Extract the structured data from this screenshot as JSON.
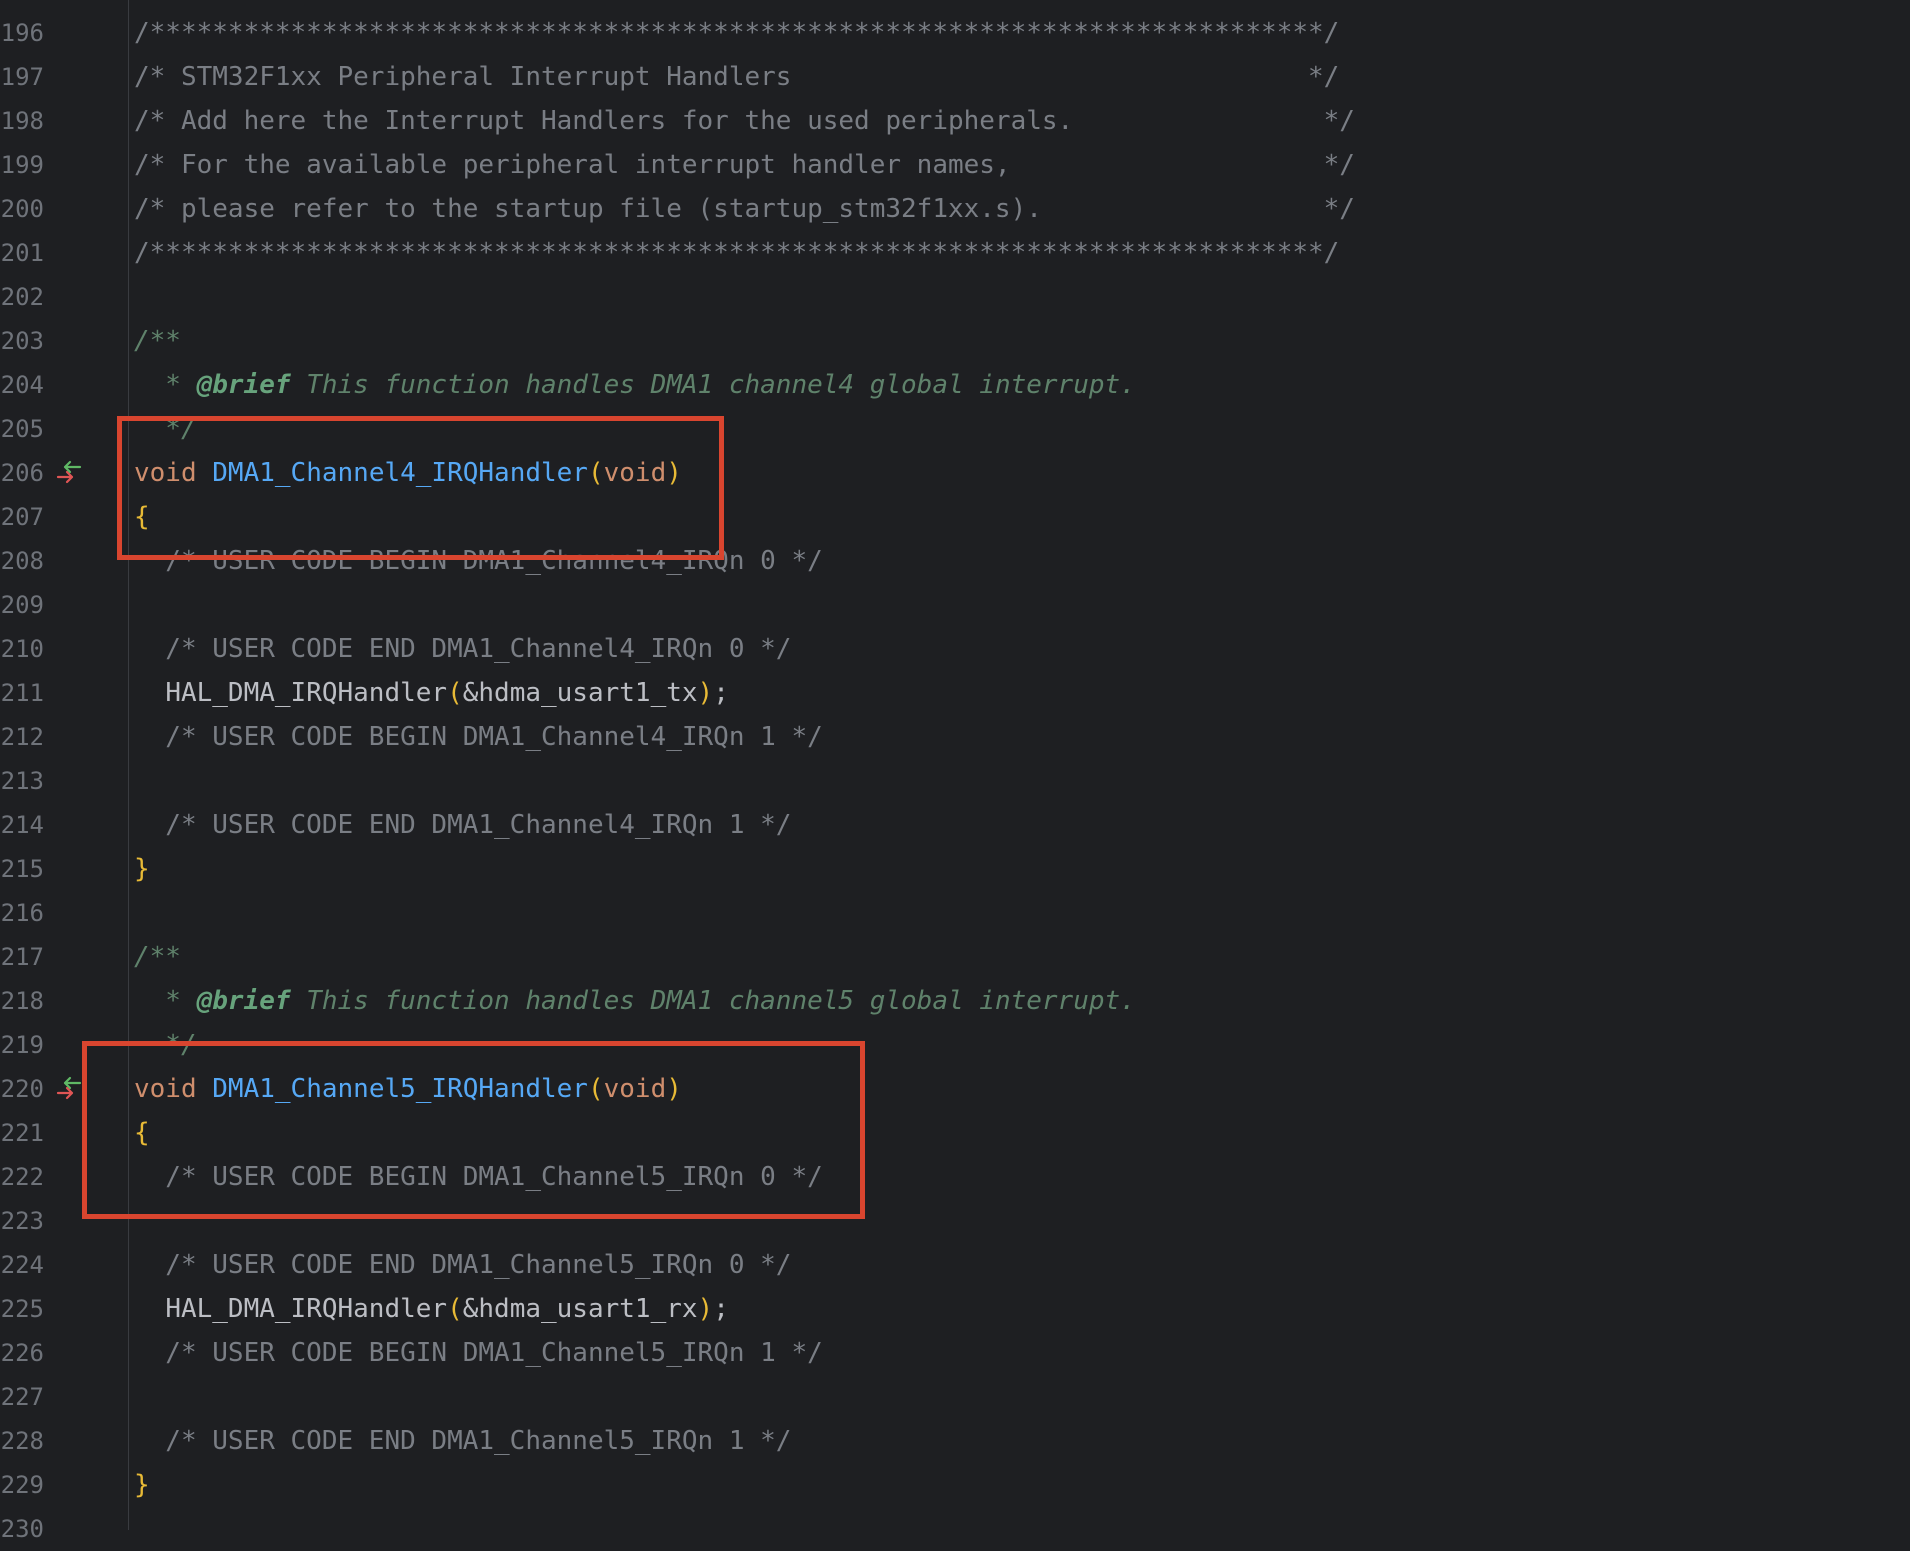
{
  "editor": {
    "lines": [
      {
        "num": "196",
        "text": "/***************************************************************************/",
        "style": "cmt"
      },
      {
        "num": "197",
        "text": "/* STM32F1xx Peripheral Interrupt Handlers                                 */",
        "style": "cmt"
      },
      {
        "num": "198",
        "text": "/* Add here the Interrupt Handlers for the used peripherals.                */",
        "style": "cmt"
      },
      {
        "num": "199",
        "text": "/* For the available peripheral interrupt handler names,                    */",
        "style": "cmt"
      },
      {
        "num": "200",
        "text": "/* please refer to the startup file (startup_stm32f1xx.s).                  */",
        "style": "cmt"
      },
      {
        "num": "201",
        "text": "/***************************************************************************/",
        "style": "cmt"
      },
      {
        "num": "202",
        "text": "",
        "style": "plain"
      },
      {
        "num": "203",
        "text": "/**",
        "style": "doc"
      },
      {
        "num": "204",
        "text": "  * @brief This function handles DMA1 channel4 global interrupt.",
        "style": "brief"
      },
      {
        "num": "205",
        "text": "  */",
        "style": "doc"
      },
      {
        "num": "206",
        "text": "void DMA1_Channel4_IRQHandler(void)",
        "style": "sig",
        "gutter_icon": "implementation-arrows-icon"
      },
      {
        "num": "207",
        "text": "{",
        "style": "brace"
      },
      {
        "num": "208",
        "text": "  /* USER CODE BEGIN DMA1_Channel4_IRQn 0 */",
        "style": "cmt"
      },
      {
        "num": "209",
        "text": "",
        "style": "plain"
      },
      {
        "num": "210",
        "text": "  /* USER CODE END DMA1_Channel4_IRQn 0 */",
        "style": "cmt"
      },
      {
        "num": "211",
        "text": "  HAL_DMA_IRQHandler(&hdma_usart1_tx);",
        "style": "call"
      },
      {
        "num": "212",
        "text": "  /* USER CODE BEGIN DMA1_Channel4_IRQn 1 */",
        "style": "cmt"
      },
      {
        "num": "213",
        "text": "",
        "style": "plain"
      },
      {
        "num": "214",
        "text": "  /* USER CODE END DMA1_Channel4_IRQn 1 */",
        "style": "cmt"
      },
      {
        "num": "215",
        "text": "}",
        "style": "brace"
      },
      {
        "num": "216",
        "text": "",
        "style": "plain"
      },
      {
        "num": "217",
        "text": "/**",
        "style": "doc"
      },
      {
        "num": "218",
        "text": "  * @brief This function handles DMA1 channel5 global interrupt.",
        "style": "brief"
      },
      {
        "num": "219",
        "text": "  */",
        "style": "doc"
      },
      {
        "num": "220",
        "text": "void DMA1_Channel5_IRQHandler(void)",
        "style": "sig",
        "gutter_icon": "implementation-arrows-icon"
      },
      {
        "num": "221",
        "text": "{",
        "style": "brace"
      },
      {
        "num": "222",
        "text": "  /* USER CODE BEGIN DMA1_Channel5_IRQn 0 */",
        "style": "cmt"
      },
      {
        "num": "223",
        "text": "",
        "style": "plain"
      },
      {
        "num": "224",
        "text": "  /* USER CODE END DMA1_Channel5_IRQn 0 */",
        "style": "cmt"
      },
      {
        "num": "225",
        "text": "  HAL_DMA_IRQHandler(&hdma_usart1_rx);",
        "style": "call"
      },
      {
        "num": "226",
        "text": "  /* USER CODE BEGIN DMA1_Channel5_IRQn 1 */",
        "style": "cmt"
      },
      {
        "num": "227",
        "text": "",
        "style": "plain"
      },
      {
        "num": "228",
        "text": "  /* USER CODE END DMA1_Channel5_IRQn 1 */",
        "style": "cmt"
      },
      {
        "num": "229",
        "text": "}",
        "style": "brace"
      },
      {
        "num": "230",
        "text": "",
        "style": "plain"
      }
    ]
  },
  "colors": {
    "background": "#1e1f22",
    "line_number": "#6f737a",
    "comment": "#7a7e85",
    "doc_comment": "#5f826b",
    "doc_tag": "#67a37c",
    "keyword": "#cf8e6d",
    "function": "#56a8f5",
    "brace": "#e8ba36",
    "plain": "#bcbec4",
    "highlight_box": "#d9452f",
    "gutter_arrow_in": "#e05555",
    "gutter_arrow_out": "#5fb865"
  }
}
